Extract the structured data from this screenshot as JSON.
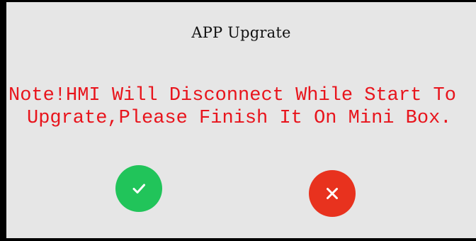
{
  "dialog": {
    "title": "APP Upgrate",
    "message_line1": "Note!HMI Will Disconnect While Start To",
    "message_line2": "Upgrate,Please Finish It On Mini Box.",
    "colors": {
      "background": "#e6e6e6",
      "message": "#e8141c",
      "confirm": "#21c45a",
      "cancel": "#e8321e"
    }
  },
  "buttons": {
    "confirm_icon": "check-icon",
    "cancel_icon": "close-icon"
  }
}
